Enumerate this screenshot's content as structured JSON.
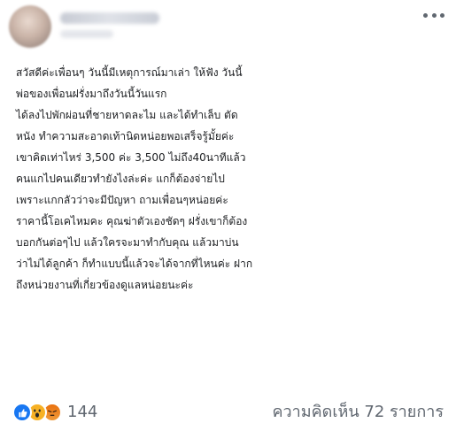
{
  "post": {
    "icons": {
      "more": "more-horizontal-icon",
      "like": "like-reaction-icon",
      "wow": "wow-reaction-icon",
      "angry": "angry-reaction-icon"
    },
    "lines": [
      "สวัสดีค่ะเพื่อนๆ  วันนี้มีเหตุการณ์มาเล่า ให้ฟัง วันนี้",
      "พ่อของเพื่อนฝรั่งมาถึงวันนี้วันแรก",
      "ได้ลงไปพักผ่อนที่ชายหาดละไม และได้ทำเล็บ ตัด",
      "หนัง ทำความสะอาดเท้านิดหน่อยพอเสร็จรู้มั้ยค่ะ",
      "เขาคิดเท่าไหร่ 3,500 ค่ะ 3,500 ไม่ถึง40นาทีแล้ว",
      "คนแกไปคนเดียวทำยังไงล่ะค่ะ แกก็ต้องจ่ายไป",
      "เพราะแกกลัวว่าจะมีปัญหา ถามเพื่อนๆหน่อยค่ะ",
      "ราคานี้โอเคไหมคะ คุณฆ่าตัวเองชัดๆ ฝรั่งเขาก็ต้อง",
      "บอกกันต่อๆไป แล้วใครจะมาทำกับคุณ แล้วมาบ่น",
      "ว่าไม่ได้ลูกค้า ก็ทำแบบนี้แล้วจะได้จากที่ไหนค่ะ ฝาก",
      "ถึงหน่วยงานที่เกี่ยวข้องดูแลหน่อยนะค่ะ"
    ]
  },
  "footer": {
    "reaction_count": "144",
    "comments": "ความคิดเห็น 72 รายการ"
  },
  "colors": {
    "like": "#1877f2",
    "wow": "#f7b125",
    "angry": "#e9710f",
    "text": "#1c1e21",
    "muted": "#606770"
  }
}
